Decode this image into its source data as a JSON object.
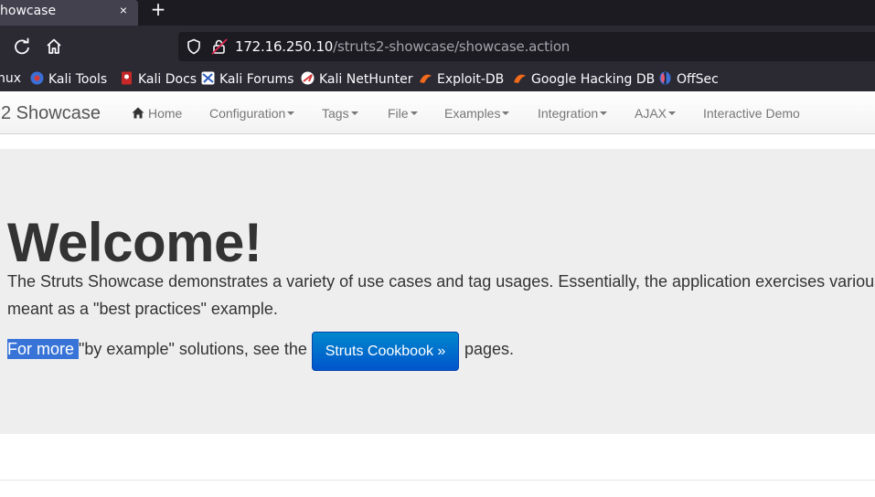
{
  "tab": {
    "title": "howcase",
    "close": "×",
    "new_tab": "+"
  },
  "nav": {
    "url_host": "172.16.250.10",
    "url_path": "/struts2-showcase/showcase.action"
  },
  "bookmarks": [
    {
      "label": "nux",
      "icon": "kali-linux-icon"
    },
    {
      "label": "Kali Tools",
      "icon": "kali-tools-icon"
    },
    {
      "label": "Kali Docs",
      "icon": "kali-docs-icon"
    },
    {
      "label": "Kali Forums",
      "icon": "kali-forums-icon"
    },
    {
      "label": "Kali NetHunter",
      "icon": "kali-nethunter-icon"
    },
    {
      "label": "Exploit-DB",
      "icon": "exploit-db-icon"
    },
    {
      "label": "Google Hacking DB",
      "icon": "ghdb-icon"
    },
    {
      "label": "OffSec",
      "icon": "offsec-icon"
    }
  ],
  "site": {
    "brand": "2 Showcase",
    "menu": {
      "home": "Home",
      "configuration": "Configuration",
      "tags": "Tags",
      "file": "File",
      "examples": "Examples",
      "integration": "Integration",
      "ajax": "AJAX",
      "interactive_demo": "Interactive Demo"
    }
  },
  "hero": {
    "title": "Welcome!",
    "desc_line1": "The Struts Showcase demonstrates a variety of use cases and tag usages. Essentially, the application exercises various",
    "desc_line2": "meant as a \"best practices\" example.",
    "selected_text": "For more ",
    "after_selected": "\"by example\" solutions, see the ",
    "button": "Struts Cookbook »",
    "after_button": "pages."
  },
  "colors": {
    "hero_bg": "#eeeeee",
    "button": "#0066cc",
    "selection": "#3874d8",
    "chrome_dark": "#2b2a33"
  }
}
